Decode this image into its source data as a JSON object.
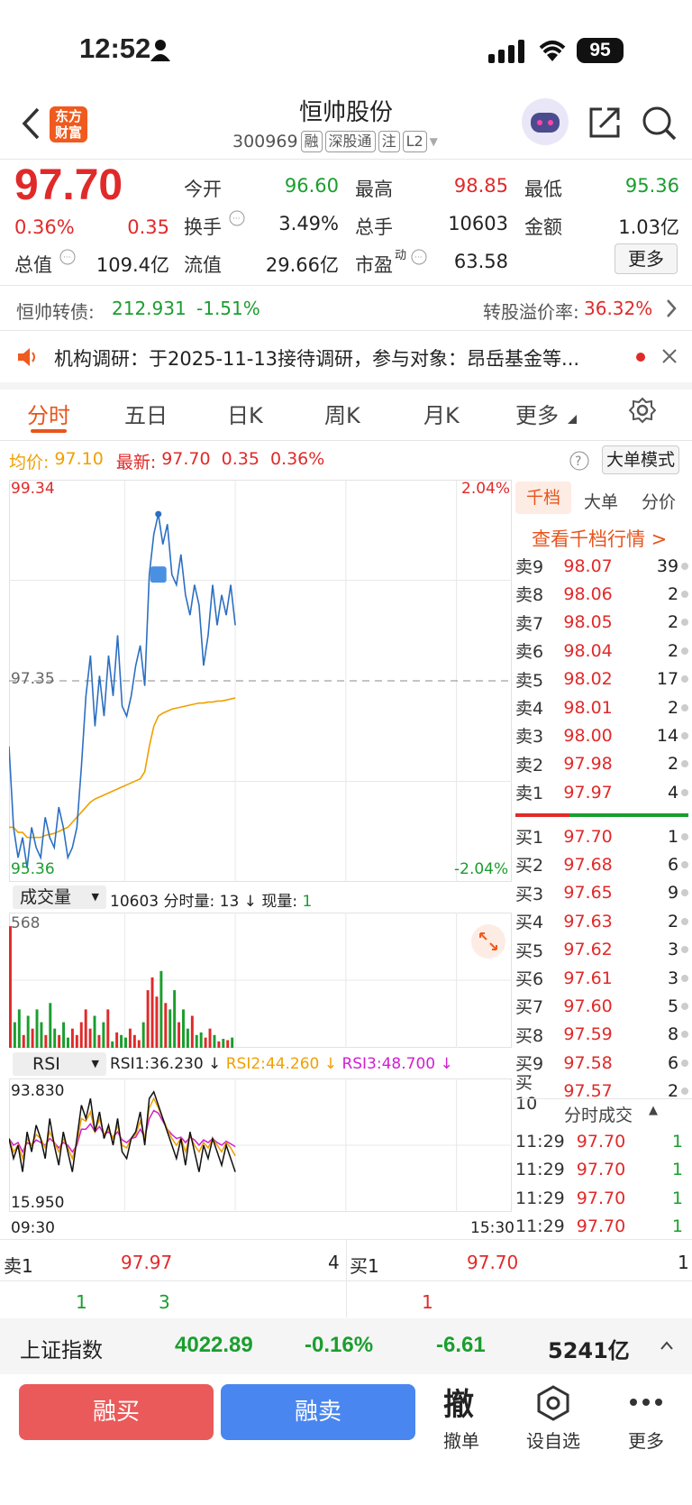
{
  "status": {
    "time": "12:52",
    "battery": "95"
  },
  "header": {
    "name": "恒帅股份",
    "code": "300969",
    "tags": [
      "融",
      "深股通",
      "注",
      "L2"
    ],
    "logo_l1": "东方",
    "logo_l2": "财富"
  },
  "quote": {
    "price": "97.70",
    "pct": "0.36%",
    "chg": "0.35",
    "open_l": "今开",
    "open": "96.60",
    "high_l": "最高",
    "high": "98.85",
    "low_l": "最低",
    "low": "95.36",
    "turn_l": "换手",
    "turn": "3.49%",
    "vol_l": "总手",
    "vol": "10603",
    "amt_l": "金额",
    "amt": "1.03亿",
    "mcap_l": "总值",
    "mcap": "109.4亿",
    "float_l": "流值",
    "float": "29.66亿",
    "pe_l": "市盈",
    "pe_sup": "动",
    "pe": "63.58",
    "more": "更多"
  },
  "bond": {
    "label": "恒帅转债:",
    "price": "212.931",
    "pct": "-1.51%",
    "prem_l": "转股溢价率:",
    "prem": "36.32%"
  },
  "notice": {
    "text": "机构调研：于2025-11-13接待调研，参与对象：昂岳基金等..."
  },
  "tabs": [
    "分时",
    "五日",
    "日K",
    "周K",
    "月K",
    "更多"
  ],
  "chart_header": {
    "avg_l": "均价:",
    "avg": "97.10",
    "last_l": "最新:",
    "last": "97.70",
    "chg": "0.35",
    "pct": "0.36%",
    "mode": "大单模式"
  },
  "chart_data": {
    "type": "line",
    "y_top": "99.34",
    "y_bottom": "95.36",
    "y_mid": "97.35",
    "pct_top": "2.04%",
    "pct_bottom": "-2.04%",
    "x_start": "09:30",
    "x_end": "15:30",
    "price": [
      96.7,
      95.9,
      95.6,
      95.8,
      95.5,
      95.9,
      95.7,
      95.6,
      96.0,
      95.8,
      95.7,
      96.1,
      95.9,
      95.6,
      95.7,
      95.9,
      96.5,
      97.2,
      97.6,
      96.9,
      97.4,
      97.0,
      97.6,
      97.2,
      97.8,
      97.1,
      97.0,
      97.2,
      97.5,
      97.7,
      97.3,
      98.4,
      98.8,
      99.0,
      98.7,
      98.9,
      98.4,
      98.3,
      98.6,
      98.2,
      98.0,
      98.3,
      98.1,
      97.5,
      97.8,
      98.3,
      97.9,
      98.2,
      98.0,
      98.3,
      97.9
    ],
    "avg": [
      95.9,
      95.9,
      95.85,
      95.85,
      95.8,
      95.8,
      95.8,
      95.8,
      95.82,
      95.83,
      95.84,
      95.86,
      95.88,
      95.9,
      95.95,
      96.0,
      96.05,
      96.1,
      96.15,
      96.18,
      96.2,
      96.22,
      96.24,
      96.26,
      96.28,
      96.3,
      96.32,
      96.34,
      96.36,
      96.38,
      96.45,
      96.7,
      96.9,
      97.0,
      97.03,
      97.05,
      97.07,
      97.08,
      97.09,
      97.1,
      97.11,
      97.12,
      97.13,
      97.13,
      97.14,
      97.14,
      97.15,
      97.15,
      97.16,
      97.17,
      97.18
    ]
  },
  "volume": {
    "label": "成交量",
    "info_total": "10603",
    "info_min_l": "分时量:",
    "info_min": "13",
    "info_cur_l": "现量:",
    "info_cur": "1",
    "max": "568",
    "bars": [
      0.95,
      0.2,
      0.3,
      0.1,
      0.25,
      0.15,
      0.3,
      0.2,
      0.1,
      0.35,
      0.15,
      0.1,
      0.2,
      0.08,
      0.15,
      0.1,
      0.2,
      0.3,
      0.15,
      0.25,
      0.1,
      0.2,
      0.3,
      0.05,
      0.12,
      0.1,
      0.08,
      0.15,
      0.1,
      0.06,
      0.2,
      0.45,
      0.55,
      0.4,
      0.6,
      0.35,
      0.3,
      0.45,
      0.2,
      0.3,
      0.15,
      0.25,
      0.1,
      0.12,
      0.08,
      0.15,
      0.1,
      0.05,
      0.07,
      0.06,
      0.08
    ]
  },
  "rsi": {
    "label": "RSI",
    "rsi1": "RSI1:36.230",
    "rsi2": "RSI2:44.260",
    "rsi3": "RSI3:48.700",
    "max": "93.830",
    "min": "15.950",
    "r1": [
      55,
      40,
      50,
      30,
      60,
      45,
      65,
      55,
      40,
      70,
      50,
      35,
      60,
      45,
      30,
      55,
      80,
      70,
      85,
      60,
      75,
      55,
      65,
      50,
      70,
      45,
      40,
      55,
      60,
      75,
      50,
      85,
      90,
      80,
      70,
      60,
      50,
      40,
      55,
      35,
      60,
      45,
      30,
      50,
      40,
      55,
      45,
      35,
      50,
      40,
      30
    ],
    "r2": [
      55,
      45,
      50,
      40,
      55,
      50,
      58,
      55,
      48,
      60,
      52,
      45,
      55,
      48,
      40,
      52,
      70,
      68,
      75,
      60,
      70,
      58,
      62,
      55,
      65,
      50,
      48,
      55,
      58,
      68,
      55,
      78,
      85,
      78,
      70,
      62,
      55,
      50,
      55,
      45,
      58,
      50,
      45,
      52,
      48,
      55,
      50,
      45,
      52,
      48,
      42
    ],
    "r3": [
      55,
      50,
      52,
      45,
      52,
      50,
      54,
      52,
      50,
      55,
      52,
      48,
      52,
      50,
      45,
      50,
      62,
      62,
      66,
      60,
      64,
      58,
      60,
      56,
      60,
      54,
      52,
      55,
      56,
      62,
      56,
      70,
      76,
      74,
      68,
      62,
      58,
      55,
      56,
      52,
      56,
      54,
      50,
      54,
      52,
      55,
      52,
      50,
      53,
      51,
      49
    ]
  },
  "book": {
    "tabs": [
      "千档",
      "大单",
      "分价"
    ],
    "link": "查看千档行情 >",
    "sells": [
      {
        "l": "卖9",
        "p": "98.07",
        "v": "39"
      },
      {
        "l": "卖8",
        "p": "98.06",
        "v": "2"
      },
      {
        "l": "卖7",
        "p": "98.05",
        "v": "2"
      },
      {
        "l": "卖6",
        "p": "98.04",
        "v": "2"
      },
      {
        "l": "卖5",
        "p": "98.02",
        "v": "17"
      },
      {
        "l": "卖4",
        "p": "98.01",
        "v": "2"
      },
      {
        "l": "卖3",
        "p": "98.00",
        "v": "14"
      },
      {
        "l": "卖2",
        "p": "97.98",
        "v": "2"
      },
      {
        "l": "卖1",
        "p": "97.97",
        "v": "4"
      }
    ],
    "buys": [
      {
        "l": "买1",
        "p": "97.70",
        "v": "1"
      },
      {
        "l": "买2",
        "p": "97.68",
        "v": "6"
      },
      {
        "l": "买3",
        "p": "97.65",
        "v": "9"
      },
      {
        "l": "买4",
        "p": "97.63",
        "v": "2"
      },
      {
        "l": "买5",
        "p": "97.62",
        "v": "3"
      },
      {
        "l": "买6",
        "p": "97.61",
        "v": "3"
      },
      {
        "l": "买7",
        "p": "97.60",
        "v": "5"
      },
      {
        "l": "买8",
        "p": "97.59",
        "v": "8"
      },
      {
        "l": "买9",
        "p": "97.58",
        "v": "6"
      },
      {
        "l": "买10",
        "p": "97.57",
        "v": "2"
      }
    ],
    "trades_label": "分时成交",
    "trades": [
      {
        "t": "11:29",
        "p": "97.70",
        "v": "1"
      },
      {
        "t": "11:29",
        "p": "97.70",
        "v": "1"
      },
      {
        "t": "11:29",
        "p": "97.70",
        "v": "1"
      },
      {
        "t": "11:29",
        "p": "97.70",
        "v": "1"
      }
    ]
  },
  "level1": {
    "sell_l": "卖1",
    "sell_p": "97.97",
    "sell_v": "4",
    "buy_l": "买1",
    "buy_p": "97.70",
    "buy_v": "1",
    "q1": "1",
    "q2": "3",
    "q3": "1"
  },
  "index": {
    "name": "上证指数",
    "value": "4022.89",
    "pct": "-0.16%",
    "chg": "-6.61",
    "amt": "5241亿"
  },
  "actions": {
    "buy": "融买",
    "sell": "融卖",
    "cancel_icon": "撤",
    "cancel": "撤单",
    "watch": "设自选",
    "more": "更多"
  }
}
